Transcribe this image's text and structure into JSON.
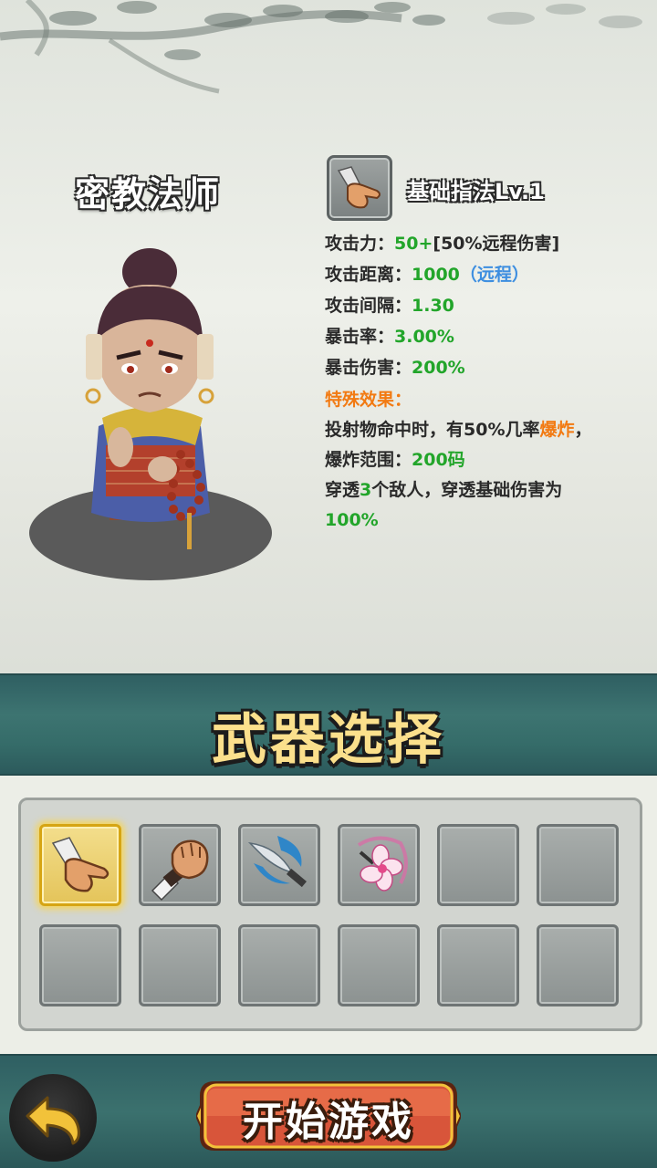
{
  "hero": {
    "name": "密教法师"
  },
  "weapon": {
    "icon": "finger-point-icon",
    "title": "基础指法Lv.1",
    "stats": [
      {
        "label": "攻击力：",
        "value": "50+",
        "extra": "[50%远程伤害]"
      },
      {
        "label": "攻击距离：",
        "value": "1000",
        "extra": "（远程）"
      },
      {
        "label": "攻击间隔：",
        "value": "1.30"
      },
      {
        "label": "暴击率：",
        "value": "3.00%"
      },
      {
        "label": "暴击伤害：",
        "value": "200%"
      }
    ],
    "special_label": "特殊效果：",
    "effect_1_a": "投射物命中时，有50%几率",
    "effect_1_b": "爆炸",
    "effect_1_c": "，",
    "effect_2_a": "爆炸范围：",
    "effect_2_b": "200码",
    "effect_3_a": "穿透",
    "effect_3_b": "3",
    "effect_3_c": "个敌人，穿透基础伤害为",
    "effect_4": "100%"
  },
  "section_title": "武器选择",
  "weapon_slots": [
    {
      "icon": "finger-point-icon",
      "selected": true
    },
    {
      "icon": "fist-icon",
      "selected": false
    },
    {
      "icon": "wave-blade-icon",
      "selected": false
    },
    {
      "icon": "flower-dart-icon",
      "selected": false
    },
    {
      "icon": "empty-slot",
      "selected": false
    },
    {
      "icon": "empty-slot",
      "selected": false
    },
    {
      "icon": "empty-slot",
      "selected": false
    },
    {
      "icon": "empty-slot",
      "selected": false
    },
    {
      "icon": "empty-slot",
      "selected": false
    },
    {
      "icon": "empty-slot",
      "selected": false
    },
    {
      "icon": "empty-slot",
      "selected": false
    },
    {
      "icon": "empty-slot",
      "selected": false
    }
  ],
  "buttons": {
    "back_icon": "back-arrow-icon",
    "start_label": "开始游戏"
  },
  "colors": {
    "stat_value": "#22a52a",
    "range_type": "#3d8ee0",
    "special": "#f27a12",
    "banner_bg": "#356c69",
    "title_gold": "#fbe08c"
  }
}
